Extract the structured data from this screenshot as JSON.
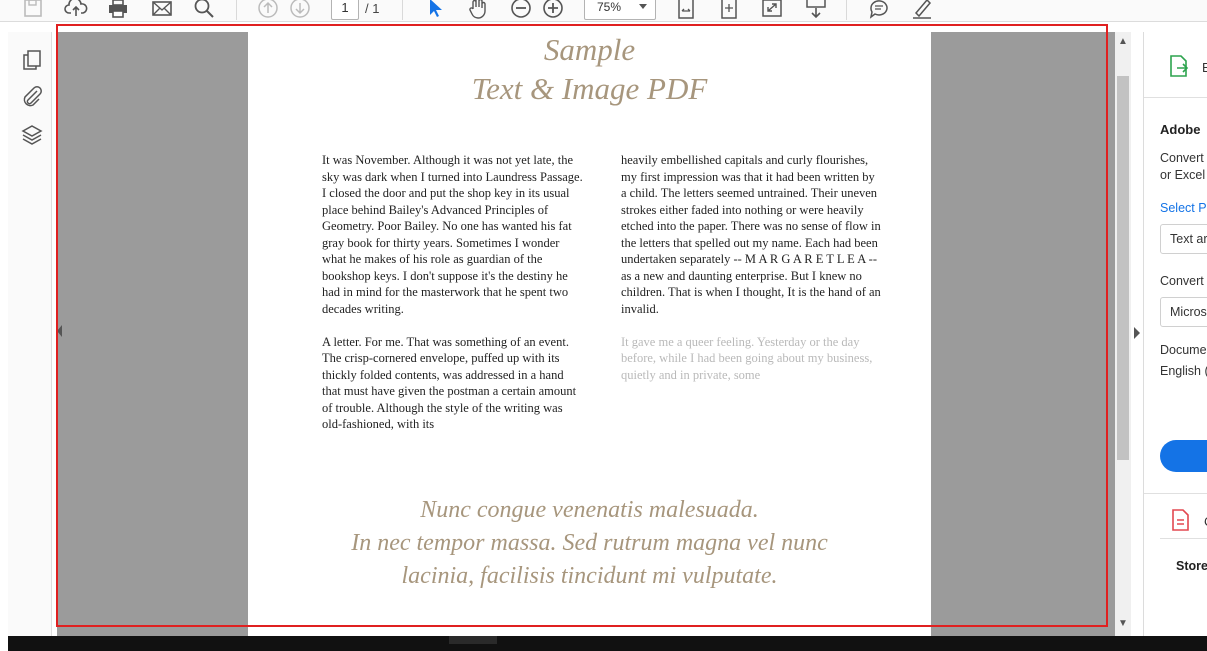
{
  "toolbar": {
    "page_current": "1",
    "page_total": "/ 1",
    "zoom": "75%",
    "icons": [
      "save-icon",
      "cloud-upload-icon",
      "print-icon",
      "mail-icon",
      "search-icon",
      "previous-page-icon",
      "next-page-icon",
      "select-cursor-icon",
      "hand-tool-icon",
      "zoom-out-icon",
      "zoom-in-icon",
      "fit-page-icon",
      "fit-width-icon",
      "full-screen-icon",
      "scroll-mode-icon",
      "comment-icon",
      "highlight-icon"
    ]
  },
  "leftnav": {
    "icons": [
      "page-thumbnails-icon",
      "attachments-icon",
      "layers-icon"
    ]
  },
  "document": {
    "title_line1": "Sample",
    "title_line2": "Text & Image PDF",
    "col1_p1": "It was November. Although it was not yet late, the sky was dark when I turned into Laundress Passage. I closed the door and put the shop key in its usual place behind Bailey's Advanced Principles of Geometry. Poor Bailey. No one has wanted his fat gray book for thirty years. Sometimes I wonder what he makes of his role as guardian of the bookshop keys. I don't suppose it's the destiny he had in mind for the masterwork that he spent two decades writing.",
    "col1_p2": "A letter. For me. That was something of an event. The crisp-cornered envelope, puffed up with its thickly folded contents, was addressed in a hand that must have given the postman a certain amount of trouble. Although the style of the writing was old-fashioned, with its",
    "col2_p1": "heavily embellished capitals and curly flourishes, my first impression was that it had been written by a child. The letters seemed untrained. Their uneven strokes either faded into nothing or were heavily etched into the paper. There was no sense of flow in the letters that spelled out my name. Each had been undertaken separately -- M A R G A R E T L E A -- as a new and daunting enterprise. But I knew no children. That is when I thought, It is the hand of an invalid.",
    "col2_p2": "It gave me a queer feeling. Yesterday or the day before, while I had been going about my business, quietly and in private, some",
    "quote_line1": "Nunc congue venenatis malesuada.",
    "quote_line2": "In nec tempor massa. Sed rutrum magna vel nunc",
    "quote_line3": "lacinia, facilisis tincidunt mi vulputate."
  },
  "rightpane": {
    "header_letter": "E",
    "title": "Adobe",
    "desc_line1": "Convert",
    "desc_line2": "or Excel",
    "select_label": "Select Pl",
    "field1_value": "Text ar",
    "convert_label": "Convert",
    "field2_value": "Micros",
    "doclang_label": "Docume",
    "doclang_value": "English (",
    "item_letter": "C",
    "store_label": "Store"
  },
  "colors": {
    "accent": "#1473e6",
    "title_brown": "#a7967d",
    "outline_red": "#e02020"
  }
}
